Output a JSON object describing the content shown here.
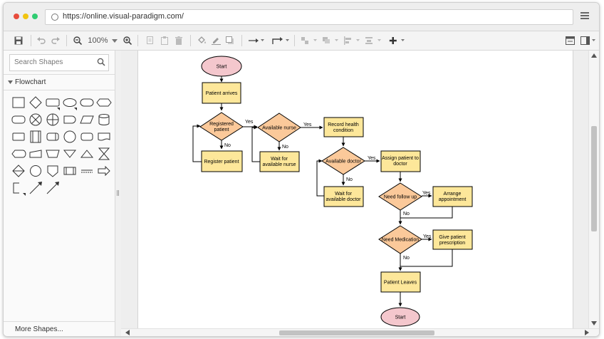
{
  "browser": {
    "url": "https://online.visual-paradigm.com/",
    "dot_colors": [
      "#e74c3c",
      "#f1c40f",
      "#2ecc71"
    ]
  },
  "toolbar": {
    "zoom": "100%"
  },
  "sidebar": {
    "search_placeholder": "Search Shapes",
    "category": "Flowchart",
    "more_shapes": "More Shapes..."
  },
  "flowchart": {
    "start_top": "Start",
    "patient_arrives": "Patient arrives",
    "registered_patient_1": "Registered",
    "registered_patient_2": "patient",
    "register_patient": "Register patient",
    "available_nurse": "Available nurse",
    "wait_nurse_1": "Wait for",
    "wait_nurse_2": "available nurse",
    "record_health_1": "Record health",
    "record_health_2": "condition",
    "available_doctor": "Available doctor",
    "wait_doctor_1": "Wait for",
    "wait_doctor_2": "available doctor",
    "assign_patient_1": "Assign patient to",
    "assign_patient_2": "doctor",
    "need_follow_up": "Need follow up",
    "arrange_1": "Arrange",
    "arrange_2": "appointment",
    "need_medication": "Need Medication",
    "give_prescription_1": "Give patient",
    "give_prescription_2": "prescription",
    "patient_leaves": "Patient Leaves",
    "start_bottom": "Start",
    "yes_1": "Yes",
    "no_1": "No",
    "yes_2": "Yes",
    "no_2": "No",
    "yes_3": "Yes",
    "no_3": "No",
    "yes_4": "Yes",
    "no_4": "No",
    "yes_5": "Yes",
    "no_5": "No"
  },
  "colors": {
    "terminal_fill": "#f4c7cd",
    "process_fill": "#fde79a",
    "decision_fill": "#fbc99a",
    "stroke": "#000000"
  }
}
